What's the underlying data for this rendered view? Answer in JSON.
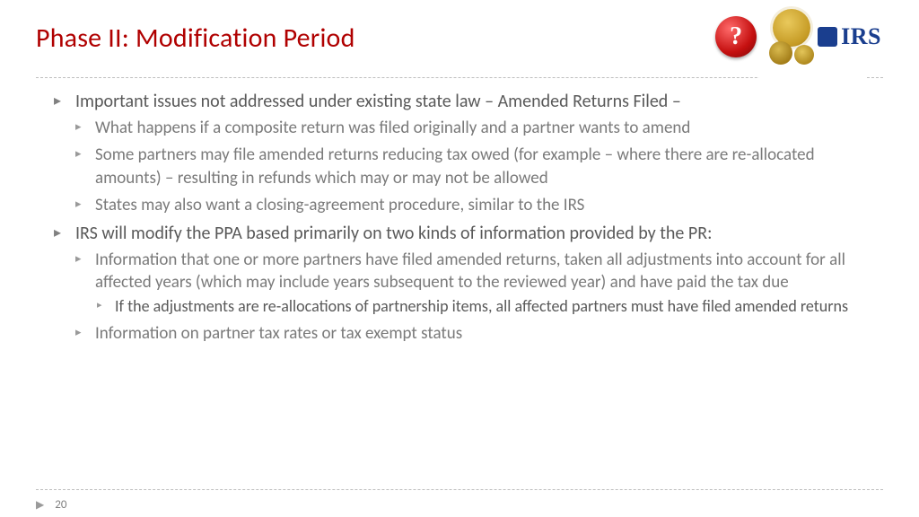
{
  "slide": {
    "title": "Phase II: Modification Period",
    "page_number": "20",
    "irs_label": "IRS",
    "help_glyph": "?"
  },
  "bullets": {
    "b1": "Important issues not addressed under existing state law – Amended Returns Filed –",
    "b1_1": "What happens if a composite return was filed originally and a partner wants to amend",
    "b1_2": "Some partners may file amended returns reducing tax owed (for example – where there are re-allocated amounts) – resulting in refunds which may or may not be allowed",
    "b1_3": "States may also want a closing-agreement procedure, similar to the IRS",
    "b2": "IRS will modify the PPA based primarily on two kinds of information provided by the PR:",
    "b2_1": "Information that one or more partners have filed amended returns, taken all adjustments into account for all affected years (which may include years subsequent to the reviewed year) and have paid the tax due",
    "b2_1_1": "If the adjustments are re-allocations of partnership items, all affected partners must have filed amended returns",
    "b2_2": "Information on partner tax rates or tax exempt status"
  }
}
